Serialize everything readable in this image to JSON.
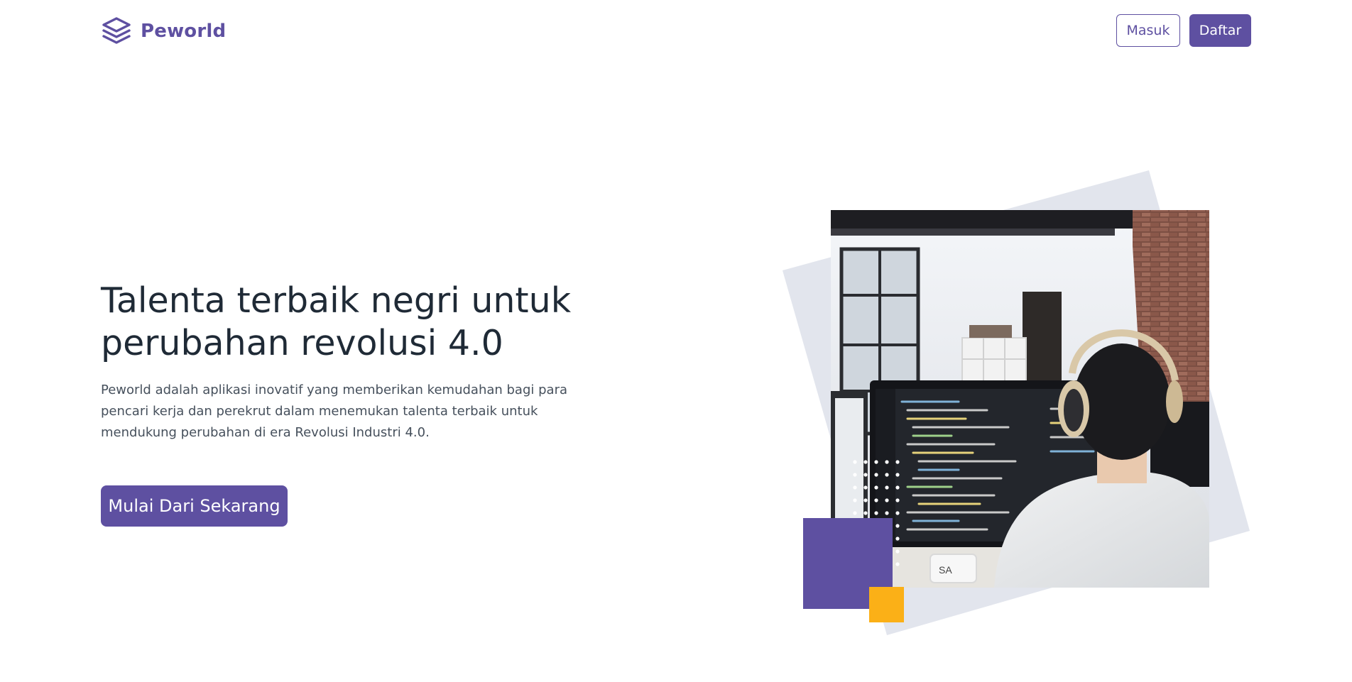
{
  "navbar": {
    "brand_name": "Peworld",
    "login_label": "Masuk",
    "register_label": "Daftar"
  },
  "hero": {
    "title_line1": "Talenta terbaik negri untuk",
    "title_line2": "perubahan revolusi 4.0",
    "description": "Peworld adalah aplikasi inovatif yang memberikan kemudahan bagi para pencari kerja dan perekrut dalam menemukan talenta terbaik untuk mendukung perubahan di era Revolusi Industri 4.0.",
    "cta_label": "Mulai Dari Sekarang",
    "image_mug_text": "SA"
  },
  "colors": {
    "brand_purple": "#5E50A1",
    "accent_yellow": "#FBB017",
    "backdrop_lavender": "#E2E5ED",
    "title_text": "#1F2A36",
    "body_text": "#46505C"
  },
  "icons": {
    "brand_logo": "stacked-layers-icon"
  }
}
